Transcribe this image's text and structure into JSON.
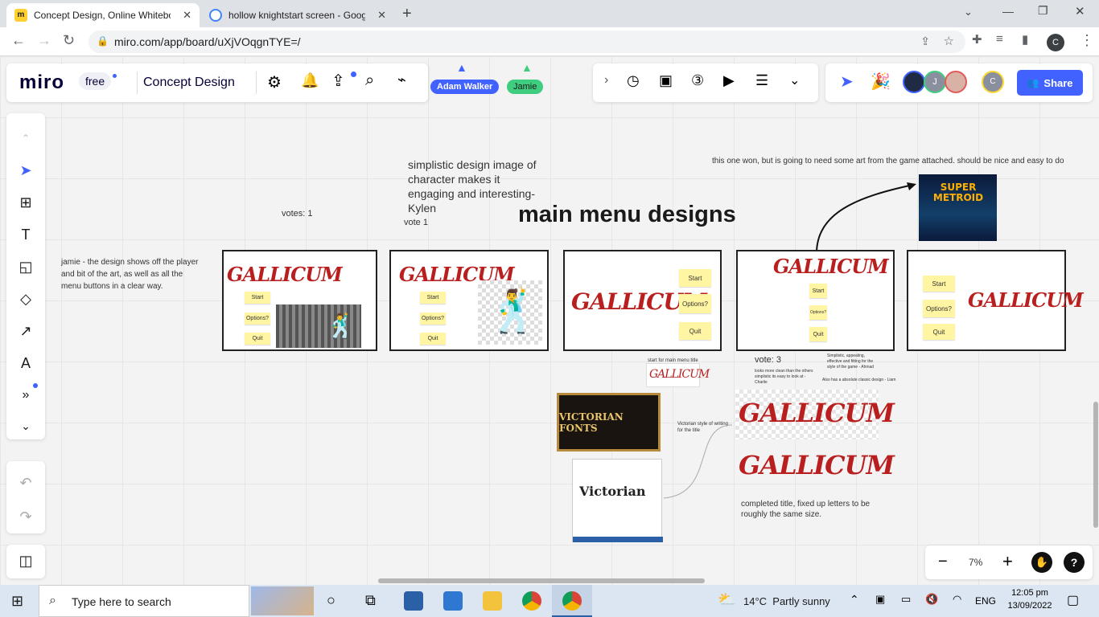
{
  "browser": {
    "tabs": [
      {
        "title": "Concept Design, Online Whitebo",
        "active": true
      },
      {
        "title": "hollow knightstart screen - Goog",
        "active": false
      }
    ],
    "url": "miro.com/app/board/uXjVOqgnTYE=/",
    "profile_initial": "C"
  },
  "miro": {
    "logo": "miro",
    "plan_badge": "free",
    "board_name": "Concept Design",
    "collaborators": [
      "Adam Walker",
      "Jamie"
    ],
    "share_label": "Share",
    "avatar_j": "J",
    "avatar_c": "C",
    "zoom": "7%",
    "help": "?"
  },
  "board": {
    "heading": "main menu designs",
    "votes_1": "votes: 1",
    "vote_1": "vote 1",
    "vote_3": "vote: 3",
    "kylen_note": "simplistic design image of character makes it engaging and interesting- Kylen",
    "jamie_note": "jamie - the design shows off the player and bit of the art, as well as all the menu buttons in a clear way.",
    "winner_note": "this one won, but is going to need some art from the game attached. should be nice and easy to do",
    "title_word": "GALLICUM",
    "menu_start": "Start",
    "menu_options": "Options?",
    "menu_quit": "Quit",
    "start_title_note": "start for main menu title",
    "victorian_note": "Victorian style of writing for the title",
    "victorian_fonts": "VICTORIAN FONTS",
    "victorian_sample": "Victorian",
    "charlie_note": "looks more clean than the others simplistic its easy to look at - Charlie",
    "ahmad_note": "Simplistic, appealing, effective and fitting for the style of the game - Ahmad",
    "liam_note": "Also has a absolute classic design - Liam",
    "completed_note": "completed title, fixed up letters to be roughly the same size.",
    "super_metroid": "SUPER METROID"
  },
  "taskbar": {
    "search_placeholder": "Type here to search",
    "weather": "14°C  Partly sunny",
    "lang": "ENG",
    "time": "12:05 pm",
    "date": "13/09/2022"
  },
  "colors": {
    "miro_blue": "#4262ff",
    "title_red": "#b91f1f",
    "sticky_yellow": "#fff5a3"
  }
}
